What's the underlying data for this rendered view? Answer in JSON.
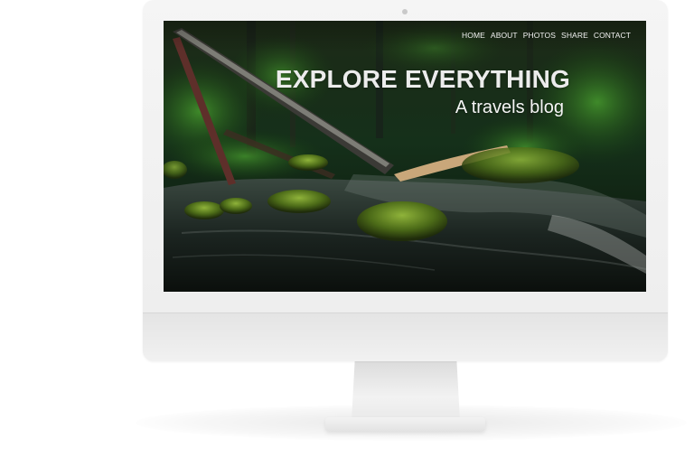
{
  "nav": {
    "items": [
      "HOME",
      "ABOUT",
      "PHOTOS",
      "SHARE",
      "CONTACT"
    ]
  },
  "hero": {
    "title": "EXPLORE EVERYTHING",
    "subtitle": "A travels blog"
  },
  "colors": {
    "device": "#f0f0f0",
    "forest_dark": "#0d140d",
    "moss": "#5a7d1e",
    "text": "#ececec"
  }
}
